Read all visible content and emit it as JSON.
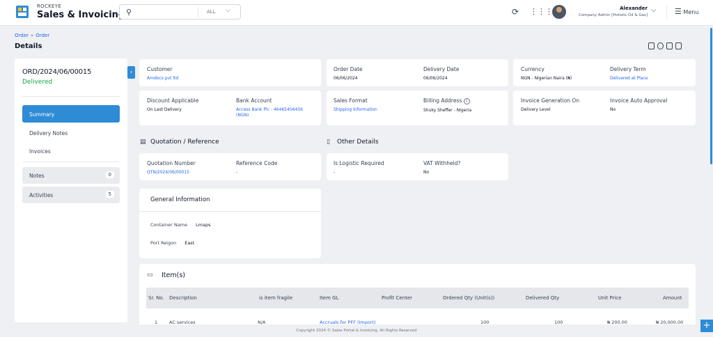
{
  "app": {
    "brand_small": "ROCKEYE",
    "brand_name": "Sales & Invoicing"
  },
  "search": {
    "scope": "ALL"
  },
  "user": {
    "name": "Alexander",
    "role": "Company Admin [Holistic Oil & Gas]"
  },
  "menu_label": "Menu",
  "breadcrumb": [
    "Order",
    "Order"
  ],
  "page_title": "Details",
  "order": {
    "number": "ORD/2024/06/00015",
    "status": "Delivered"
  },
  "sidebar": {
    "items": [
      {
        "label": "Summary"
      },
      {
        "label": "Delivery Notes"
      },
      {
        "label": "Invoices"
      }
    ],
    "notes": {
      "label": "Notes",
      "count": "0"
    },
    "activities": {
      "label": "Activities",
      "count": "5"
    }
  },
  "fields": {
    "customer": {
      "label": "Customer",
      "value": "Amdocs pvt ltd"
    },
    "order_date": {
      "label": "Order Date",
      "value": "06/06/2024"
    },
    "delivery_date": {
      "label": "Delivery Date",
      "value": "06/06/2024"
    },
    "currency": {
      "label": "Currency",
      "value": "NGN - Nigerian Naira (₦)"
    },
    "delivery_term": {
      "label": "Delivery Term",
      "value": "Delivered at Place"
    },
    "discount": {
      "label": "Discount Applicable",
      "value": "On Last Delivery"
    },
    "bank_account": {
      "label": "Bank Account",
      "value": "Access Bank Plc - 46465456456 (NGN)"
    },
    "sales_format": {
      "label": "Sales Format",
      "value": "Shipping Information"
    },
    "billing_address": {
      "label": "Billing Address",
      "value": "Shuky Sheffer - Nigeria"
    },
    "invoice_generation": {
      "label": "Invoice Generation On",
      "value": "Delivery Level"
    },
    "invoice_auto_approval": {
      "label": "Invoice Auto Approval",
      "value": "No"
    }
  },
  "quotation": {
    "title": "Quotation / Reference",
    "number": {
      "label": "Quotation Number",
      "value": "QTN/2024/06/00015"
    },
    "reference": {
      "label": "Reference Code",
      "value": "-"
    }
  },
  "other": {
    "title": "Other Details",
    "logistic": {
      "label": "Is Logistic Required",
      "value": "-"
    },
    "vat": {
      "label": "VAT Withheld?",
      "value": "No"
    }
  },
  "general": {
    "title": "General Information",
    "container": {
      "label": "Container Name",
      "value": "Lmaps"
    },
    "port": {
      "label": "Port Reigon",
      "value": "East"
    }
  },
  "items": {
    "title": "Item(s)",
    "columns": [
      "Sr. No.",
      "Description",
      "is item fragile",
      "Item GL",
      "Profit Center",
      "Ordered Qty (Unit(s))",
      "Delivered Qty",
      "Unit Price",
      "Amount"
    ],
    "row": [
      "1",
      "AC services",
      "N/A",
      "Accruals for PFF (Import)",
      "",
      "100",
      "100",
      "₦ 200.00",
      "₦ 20,000.00"
    ]
  },
  "footer": "Copyright 2024 © Sales Portal & Invoicing. All Rights Reserved"
}
